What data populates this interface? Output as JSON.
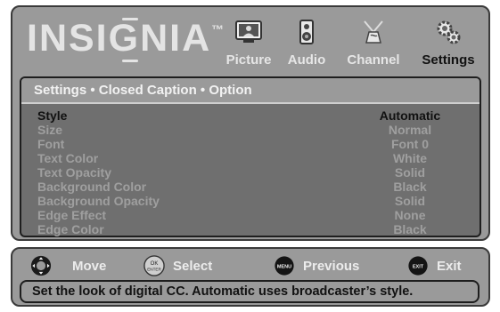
{
  "brand": {
    "logo_text": "INSIGNIA",
    "trademark": "™"
  },
  "tabs": [
    {
      "label": "Picture",
      "icon": "picture-icon",
      "active": false
    },
    {
      "label": "Audio",
      "icon": "audio-icon",
      "active": false
    },
    {
      "label": "Channel",
      "icon": "channel-icon",
      "active": false
    },
    {
      "label": "Settings",
      "icon": "settings-icon",
      "active": true
    }
  ],
  "breadcrumb": "Settings • Closed Caption • Option",
  "options": [
    {
      "label": "Style",
      "value": "Automatic",
      "selected": true
    },
    {
      "label": "Size",
      "value": "Normal",
      "selected": false
    },
    {
      "label": "Font",
      "value": "Font 0",
      "selected": false
    },
    {
      "label": "Text Color",
      "value": "White",
      "selected": false
    },
    {
      "label": "Text Opacity",
      "value": "Solid",
      "selected": false
    },
    {
      "label": "Background Color",
      "value": "Black",
      "selected": false
    },
    {
      "label": "Background Opacity",
      "value": "Solid",
      "selected": false
    },
    {
      "label": "Edge Effect",
      "value": "None",
      "selected": false
    },
    {
      "label": "Edge Color",
      "value": "Black",
      "selected": false
    }
  ],
  "nav_hints": {
    "move": {
      "label": "Move",
      "icon": "dpad-icon"
    },
    "select": {
      "label": "Select",
      "icon": "ok-enter-icon",
      "button_text": "OK ENTER"
    },
    "previous": {
      "label": "Previous",
      "icon": "menu-button-icon",
      "button_text": "MENU"
    },
    "exit": {
      "label": "Exit",
      "icon": "exit-button-icon",
      "button_text": "EXIT"
    }
  },
  "help_text": "Set the look of digital CC. Automatic uses broadcaster’s style.",
  "colors": {
    "panel": "#9a9a9a",
    "menu": "#6f6f6f",
    "selected_text": "#111111",
    "dim_text": "#9f9f9f"
  }
}
